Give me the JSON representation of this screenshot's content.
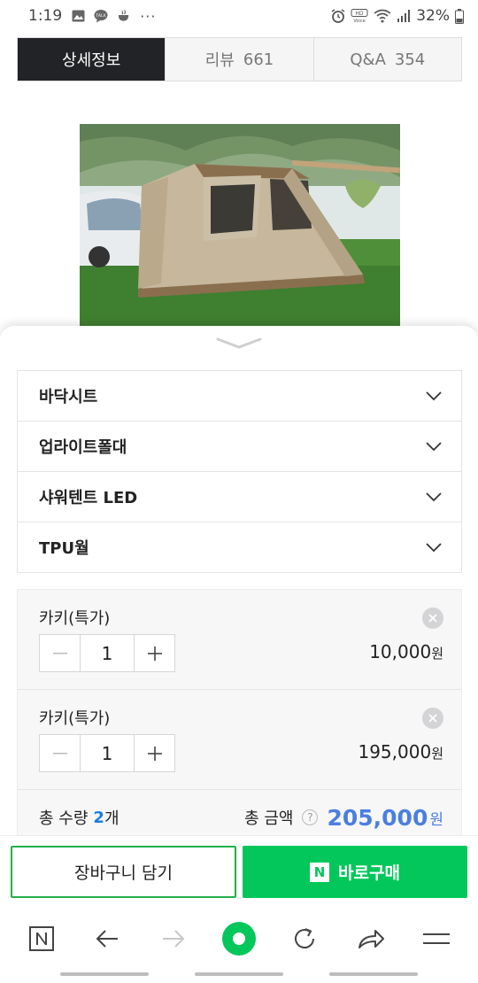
{
  "status_bar": {
    "time": "1:19",
    "icons_left": [
      "photo-icon",
      "talk-icon",
      "cup-icon",
      "more-dots-icon"
    ],
    "more_dots": "···",
    "icons_right": [
      "alarm-icon",
      "hd-voice-icon",
      "wifi-icon",
      "signal-icon",
      "battery-icon"
    ],
    "battery": "32%"
  },
  "tabs": [
    {
      "label": "상세정보",
      "count": ""
    },
    {
      "label": "리뷰",
      "count": "661"
    },
    {
      "label": "Q&A",
      "count": "354"
    }
  ],
  "options": [
    {
      "label": "바닥시트"
    },
    {
      "label": "업라이트폴대"
    },
    {
      "label": "샤워텐트 LED"
    },
    {
      "label": "TPU월"
    }
  ],
  "selected_items": [
    {
      "name": "카키(특가)",
      "qty": "1",
      "price": "10,000",
      "won": "원"
    },
    {
      "name": "카키(특가)",
      "qty": "1",
      "price": "195,000",
      "won": "원"
    }
  ],
  "summary": {
    "qty_label": "총 수량",
    "qty_value": "2",
    "qty_unit": "개",
    "amount_label": "총 금액",
    "help": "?",
    "amount_value": "205,000",
    "amount_won": "원"
  },
  "actions": {
    "cart_label": "장바구니 담기",
    "buy_badge": "N",
    "buy_label": "바로구매"
  },
  "colors": {
    "accent_green": "#03c75a",
    "price_blue": "#4a7fe0",
    "tab_active": "#222326"
  },
  "browser_nav": [
    "naver-n-icon",
    "back-arrow-icon",
    "forward-arrow-icon",
    "home-dot-icon",
    "refresh-icon",
    "share-icon",
    "menu-icon"
  ]
}
